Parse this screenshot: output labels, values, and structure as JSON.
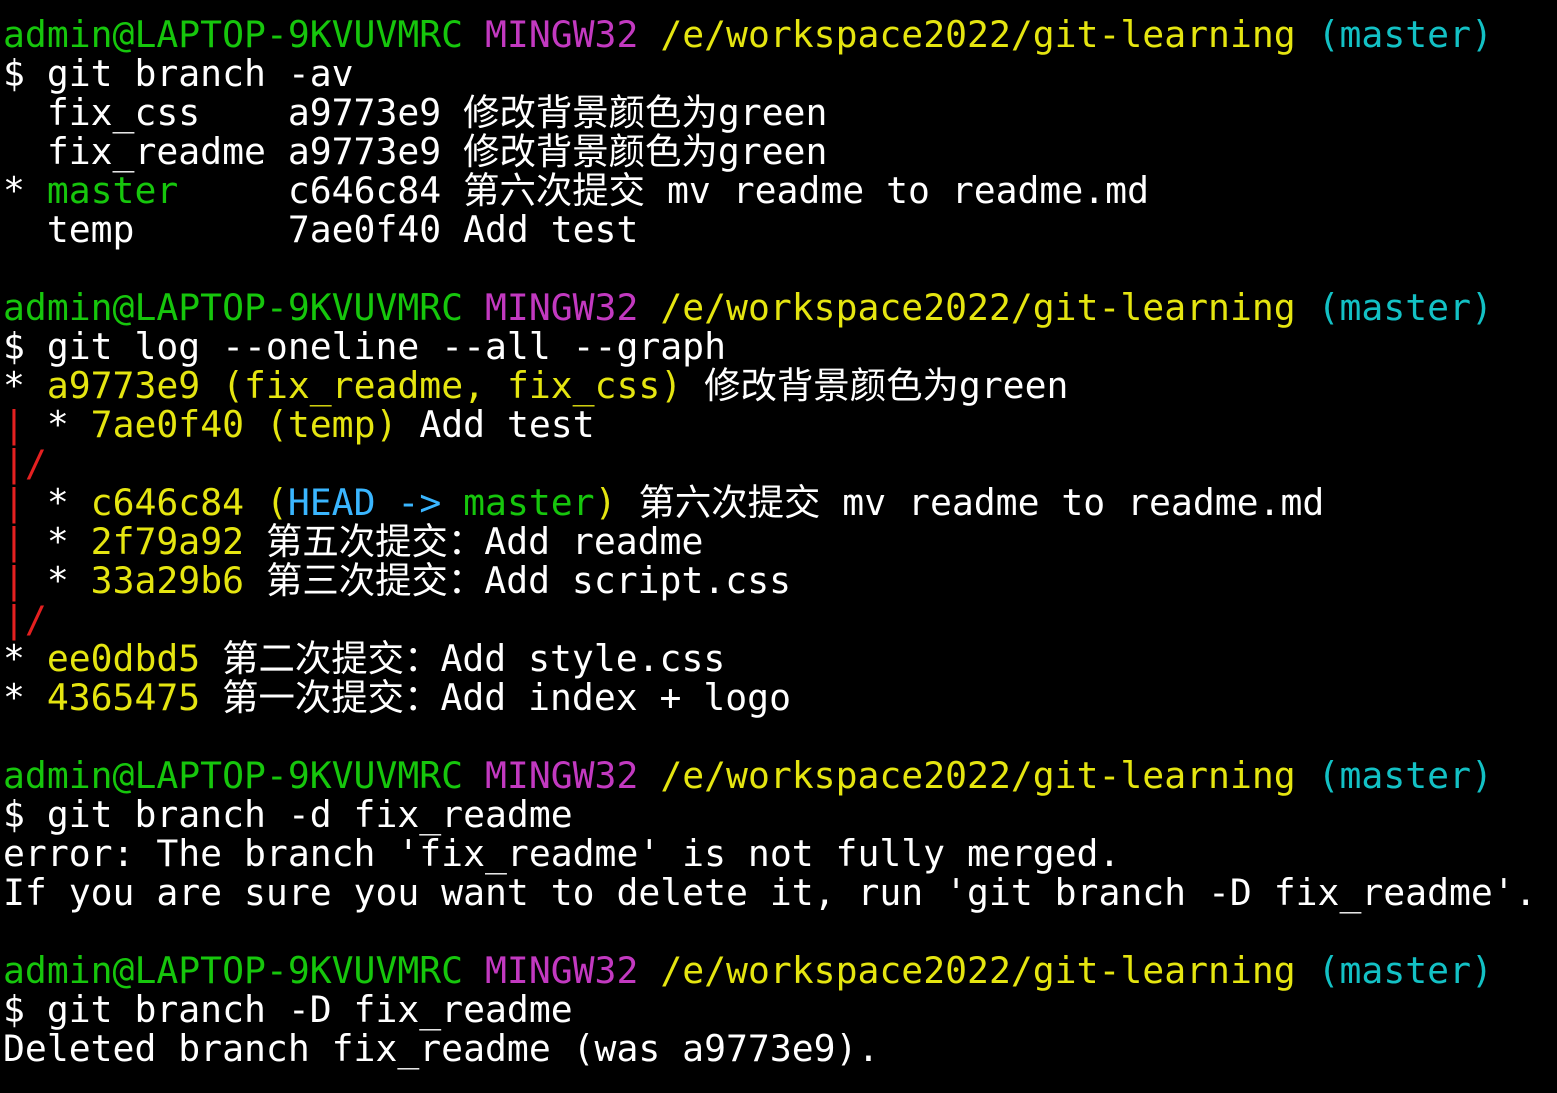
{
  "colors": {
    "background": "#000000",
    "default": "#ffffff",
    "user_host": "#16c60c",
    "env": "#c239c0",
    "path": "#e5e510",
    "branch_paren": "#13c1c5",
    "hash": "#e5e510",
    "current_branch": "#16c60c",
    "graph_red": "#e52020",
    "head": "#3ab6ff"
  },
  "lines": [
    {
      "segments": [
        {
          "text": "admin@LAPTOP-9KVUVMRC",
          "color": "user_host"
        },
        {
          "text": " ",
          "color": "default"
        },
        {
          "text": "MINGW32",
          "color": "env"
        },
        {
          "text": " ",
          "color": "default"
        },
        {
          "text": "/e/workspace2022/git-learning",
          "color": "path"
        },
        {
          "text": " ",
          "color": "default"
        },
        {
          "text": "(master)",
          "color": "branch_paren"
        }
      ]
    },
    {
      "segments": [
        {
          "text": "$ git branch -av",
          "color": "default"
        }
      ]
    },
    {
      "segments": [
        {
          "text": "  fix_css    a9773e9 修改背景颜色为green",
          "color": "default"
        }
      ]
    },
    {
      "segments": [
        {
          "text": "  fix_readme a9773e9 修改背景颜色为green",
          "color": "default"
        }
      ]
    },
    {
      "segments": [
        {
          "text": "* ",
          "color": "default"
        },
        {
          "text": "master",
          "color": "current_branch"
        },
        {
          "text": "     c646c84 第六次提交 mv readme to readme.md",
          "color": "default"
        }
      ]
    },
    {
      "segments": [
        {
          "text": "  temp       7ae0f40 Add test",
          "color": "default"
        }
      ]
    },
    {
      "segments": []
    },
    {
      "segments": [
        {
          "text": "admin@LAPTOP-9KVUVMRC",
          "color": "user_host"
        },
        {
          "text": " ",
          "color": "default"
        },
        {
          "text": "MINGW32",
          "color": "env"
        },
        {
          "text": " ",
          "color": "default"
        },
        {
          "text": "/e/workspace2022/git-learning",
          "color": "path"
        },
        {
          "text": " ",
          "color": "default"
        },
        {
          "text": "(master)",
          "color": "branch_paren"
        }
      ]
    },
    {
      "segments": [
        {
          "text": "$ git log --oneline --all --graph",
          "color": "default"
        }
      ]
    },
    {
      "segments": [
        {
          "text": "* ",
          "color": "default"
        },
        {
          "text": "a9773e9",
          "color": "hash"
        },
        {
          "text": " ",
          "color": "default"
        },
        {
          "text": "(fix_readme, fix_css)",
          "color": "hash"
        },
        {
          "text": " 修改背景颜色为green",
          "color": "default"
        }
      ]
    },
    {
      "segments": [
        {
          "text": "|",
          "color": "graph_red"
        },
        {
          "text": " * ",
          "color": "default"
        },
        {
          "text": "7ae0f40",
          "color": "hash"
        },
        {
          "text": " ",
          "color": "default"
        },
        {
          "text": "(temp)",
          "color": "hash"
        },
        {
          "text": " Add test",
          "color": "default"
        }
      ]
    },
    {
      "segments": [
        {
          "text": "|/",
          "color": "graph_red"
        }
      ]
    },
    {
      "segments": [
        {
          "text": "|",
          "color": "graph_red"
        },
        {
          "text": " * ",
          "color": "default"
        },
        {
          "text": "c646c84",
          "color": "hash"
        },
        {
          "text": " (",
          "color": "hash"
        },
        {
          "text": "HEAD -> ",
          "color": "head"
        },
        {
          "text": "master",
          "color": "current_branch"
        },
        {
          "text": ")",
          "color": "hash"
        },
        {
          "text": " 第六次提交 mv readme to readme.md",
          "color": "default"
        }
      ]
    },
    {
      "segments": [
        {
          "text": "|",
          "color": "graph_red"
        },
        {
          "text": " * ",
          "color": "default"
        },
        {
          "text": "2f79a92",
          "color": "hash"
        },
        {
          "text": " 第五次提交：Add readme",
          "color": "default"
        }
      ]
    },
    {
      "segments": [
        {
          "text": "|",
          "color": "graph_red"
        },
        {
          "text": " * ",
          "color": "default"
        },
        {
          "text": "33a29b6",
          "color": "hash"
        },
        {
          "text": " 第三次提交：Add script.css",
          "color": "default"
        }
      ]
    },
    {
      "segments": [
        {
          "text": "|/",
          "color": "graph_red"
        }
      ]
    },
    {
      "segments": [
        {
          "text": "* ",
          "color": "default"
        },
        {
          "text": "ee0dbd5",
          "color": "hash"
        },
        {
          "text": " 第二次提交：Add style.css",
          "color": "default"
        }
      ]
    },
    {
      "segments": [
        {
          "text": "* ",
          "color": "default"
        },
        {
          "text": "4365475",
          "color": "hash"
        },
        {
          "text": " 第一次提交：Add index + logo",
          "color": "default"
        }
      ]
    },
    {
      "segments": []
    },
    {
      "segments": [
        {
          "text": "admin@LAPTOP-9KVUVMRC",
          "color": "user_host"
        },
        {
          "text": " ",
          "color": "default"
        },
        {
          "text": "MINGW32",
          "color": "env"
        },
        {
          "text": " ",
          "color": "default"
        },
        {
          "text": "/e/workspace2022/git-learning",
          "color": "path"
        },
        {
          "text": " ",
          "color": "default"
        },
        {
          "text": "(master)",
          "color": "branch_paren"
        }
      ]
    },
    {
      "segments": [
        {
          "text": "$ git branch -d fix_readme",
          "color": "default"
        }
      ]
    },
    {
      "segments": [
        {
          "text": "error: The branch 'fix_readme' is not fully merged.",
          "color": "default"
        }
      ]
    },
    {
      "segments": [
        {
          "text": "If you are sure you want to delete it, run 'git branch -D fix_readme'.",
          "color": "default"
        }
      ]
    },
    {
      "segments": []
    },
    {
      "segments": [
        {
          "text": "admin@LAPTOP-9KVUVMRC",
          "color": "user_host"
        },
        {
          "text": " ",
          "color": "default"
        },
        {
          "text": "MINGW32",
          "color": "env"
        },
        {
          "text": " ",
          "color": "default"
        },
        {
          "text": "/e/workspace2022/git-learning",
          "color": "path"
        },
        {
          "text": " ",
          "color": "default"
        },
        {
          "text": "(master)",
          "color": "branch_paren"
        }
      ]
    },
    {
      "segments": [
        {
          "text": "$ git branch -D fix_readme",
          "color": "default"
        }
      ]
    },
    {
      "segments": [
        {
          "text": "Deleted branch fix_readme (was a9773e9).",
          "color": "default"
        }
      ]
    }
  ]
}
